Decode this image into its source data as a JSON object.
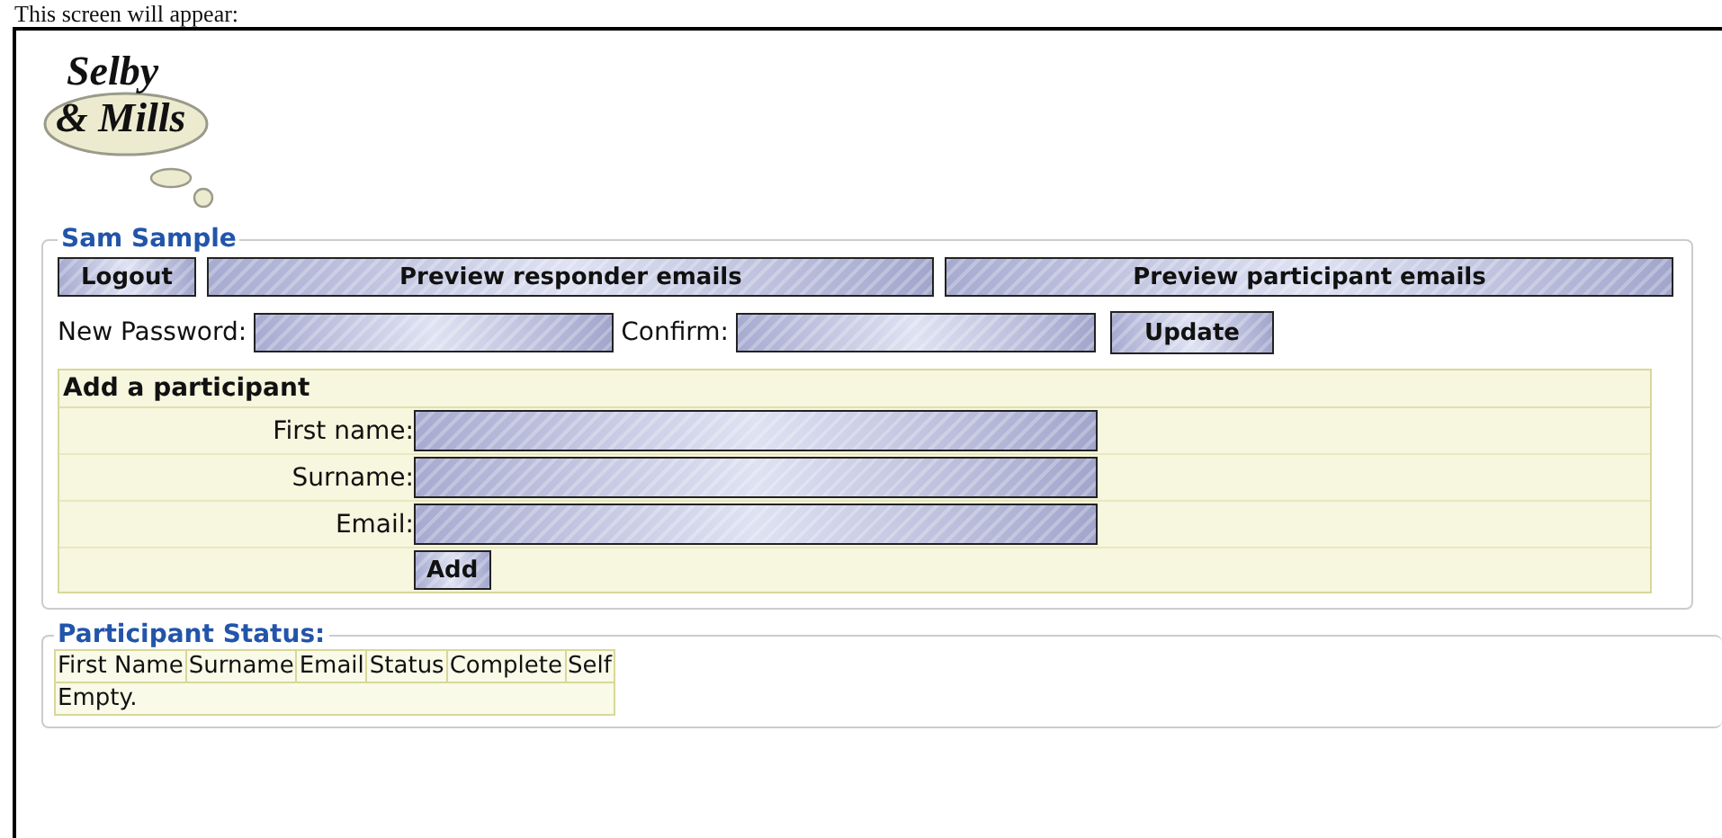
{
  "caption": "This screen will appear:",
  "logo": {
    "line1": "Selby",
    "line2": "& Mills"
  },
  "account": {
    "legend": "Sam Sample",
    "buttons": [
      "Logout",
      "Preview responder emails",
      "Preview participant emails"
    ],
    "new_password_label": "New Password:",
    "confirm_label": "Confirm:",
    "update_button": "Update"
  },
  "add_participant": {
    "title": "Add a participant",
    "fields": [
      {
        "label": "First name:"
      },
      {
        "label": "Surname:"
      },
      {
        "label": "Email:"
      }
    ],
    "add_button": "Add"
  },
  "participant_status": {
    "legend": "Participant Status:",
    "columns": [
      "First Name",
      "Surname",
      "Email",
      "Status",
      "Complete",
      "Self"
    ],
    "empty_text": "Empty."
  }
}
